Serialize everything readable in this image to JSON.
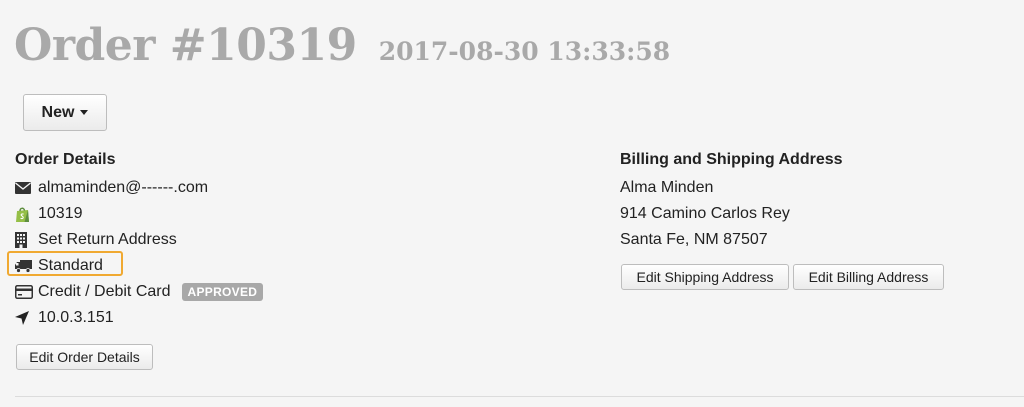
{
  "header": {
    "title": "Order #10319",
    "date": "2017-08-30 13:33:58"
  },
  "toolbar": {
    "new_label": "New"
  },
  "order_details": {
    "title": "Order Details",
    "email": "almaminden@------.com",
    "store_order_number": "10319",
    "return_address": "Set Return Address",
    "shipping_method": "Standard",
    "payment_method": "Credit / Debit Card",
    "payment_status": "APPROVED",
    "ip_address": "10.0.3.151",
    "edit_button": "Edit Order Details"
  },
  "address": {
    "title": "Billing and Shipping Address",
    "name": "Alma Minden",
    "street": "914 Camino Carlos Rey",
    "city_state_zip": "Santa Fe, NM 87507",
    "edit_shipping_button": "Edit Shipping Address",
    "edit_billing_button": "Edit Billing Address"
  },
  "colors": {
    "highlight": "#f0a931",
    "badge_bg": "#a8a8a8",
    "title_gray": "#a9a9a9",
    "shopify_green": "#95bf47"
  }
}
